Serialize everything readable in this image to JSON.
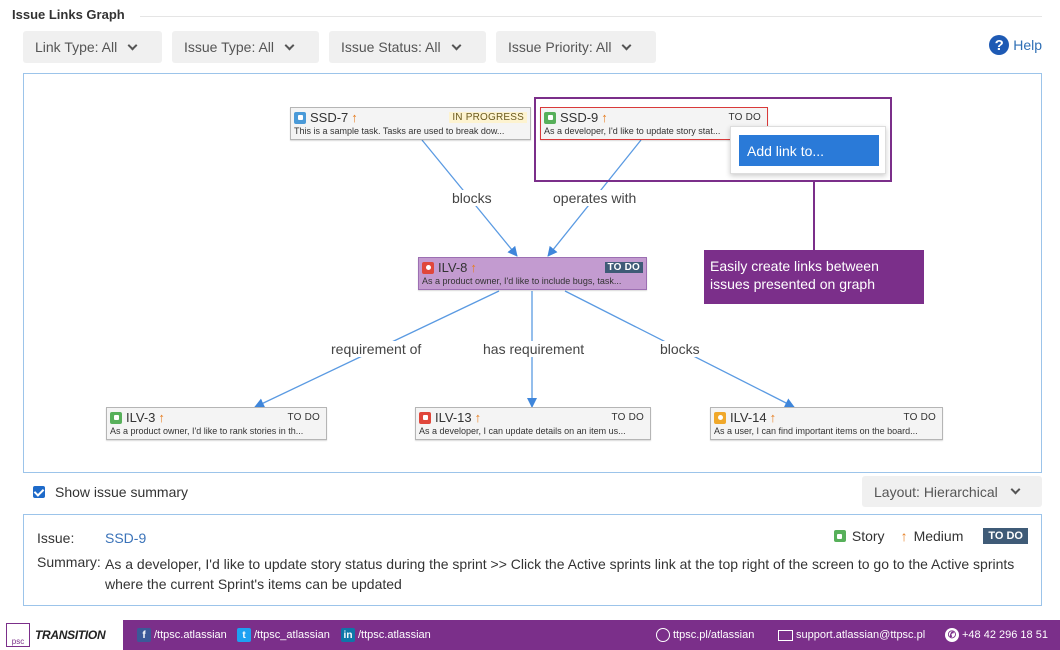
{
  "header": {
    "title": "Issue Links Graph",
    "help_label": "Help"
  },
  "filters": [
    {
      "label": "Link Type: All"
    },
    {
      "label": "Issue Type: All"
    },
    {
      "label": "Issue Status: All"
    },
    {
      "label": "Issue Priority: All"
    }
  ],
  "graph": {
    "nodes": {
      "ssd7": {
        "key": "SSD-7",
        "status": "IN PROGRESS",
        "summary": "This is a sample task. Tasks are used to break dow...",
        "type_icon": "task-icon"
      },
      "ssd9": {
        "key": "SSD-9",
        "status": "TO DO",
        "summary": "As a developer, I'd like to update story stat...",
        "type_icon": "story-icon"
      },
      "ilv8": {
        "key": "ILV-8",
        "status": "TO DO",
        "summary": "As a product owner, I'd like to include bugs, task...",
        "type_icon": "bug-icon"
      },
      "ilv3": {
        "key": "ILV-3",
        "status": "TO DO",
        "summary": "As a product owner, I'd like to rank stories in th...",
        "type_icon": "improvement-icon"
      },
      "ilv13": {
        "key": "ILV-13",
        "status": "TO DO",
        "summary": "As a developer, I can update details on an item us...",
        "type_icon": "blocker-icon"
      },
      "ilv14": {
        "key": "ILV-14",
        "status": "TO DO",
        "summary": "As a user, I can find important items on the board...",
        "type_icon": "idea-icon"
      }
    },
    "edges": {
      "e1": "blocks",
      "e2": "operates with",
      "e3": "requirement of",
      "e4": "has requirement",
      "e5": "blocks"
    },
    "context_menu": {
      "add_link": "Add link to..."
    },
    "callout": "Easily create links between issues presented on graph"
  },
  "options": {
    "show_summary_label": "Show issue summary",
    "show_summary_checked": true,
    "layout_label": "Layout: Hierarchical"
  },
  "details": {
    "issue_label": "Issue:",
    "issue_key": "SSD-9",
    "summary_label": "Summary:",
    "summary": "As a developer, I'd like to update story status during the sprint >> Click the Active sprints link at the top right of the screen to go to the Active sprints where the current Sprint's items can be updated",
    "type": "Story",
    "priority": "Medium",
    "status": "TO DO"
  },
  "footer": {
    "brand": "TRANSITION",
    "logo_text": "psc",
    "facebook": "/ttpsc.atlassian",
    "twitter": "/ttpsc_atlassian",
    "linkedin": "/ttpsc.atlassian",
    "website": "ttpsc.pl/atlassian",
    "email": "support.atlassian@ttpsc.pl",
    "phone": "+48 42 296 18 51"
  },
  "colors": {
    "accent": "#7b2f8a",
    "link": "#2a7ad8",
    "edge": "#4a90e2",
    "selected_node": "#c39bd0"
  }
}
